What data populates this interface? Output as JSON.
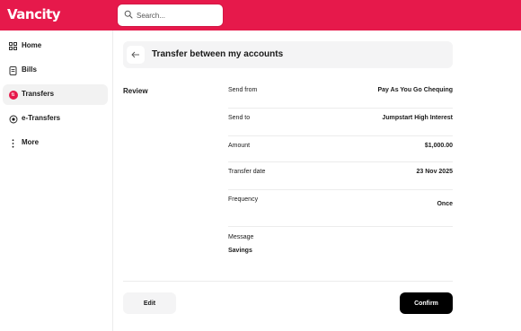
{
  "brand": {
    "logo_text": "Vancity",
    "accent_color": "#e6194b"
  },
  "search": {
    "placeholder": "Search..."
  },
  "sidebar": {
    "items": [
      {
        "label": "Home",
        "icon": "grid-icon"
      },
      {
        "label": "Bills",
        "icon": "receipt-icon"
      },
      {
        "label": "Transfers",
        "icon": "transfers-badge-icon",
        "active": true
      },
      {
        "label": "e-Transfers",
        "icon": "etransfer-icon"
      },
      {
        "label": "More",
        "icon": "more-vertical-icon"
      }
    ]
  },
  "header": {
    "title": "Transfer between my accounts"
  },
  "review": {
    "section_label": "Review",
    "rows": [
      {
        "label": "Send from",
        "value": "Pay As You Go Chequing"
      },
      {
        "label": "Send to",
        "value": "Jumpstart High Interest"
      },
      {
        "label": "Amount",
        "value": "$1,000.00"
      },
      {
        "label": "Transfer date",
        "value": "23 Nov 2025"
      },
      {
        "label": "Frequency",
        "value": "Once"
      },
      {
        "label": "Message",
        "value": "Savings"
      }
    ]
  },
  "actions": {
    "edit_label": "Edit",
    "confirm_label": "Confirm"
  }
}
